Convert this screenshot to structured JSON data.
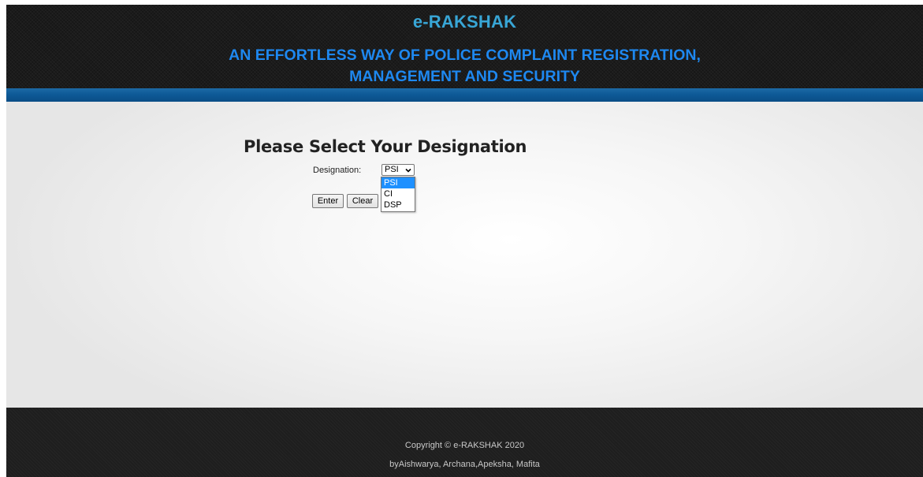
{
  "header": {
    "title": "e-RAKSHAK",
    "tagline_line1": "AN EFFORTLESS WAY OF POLICE COMPLAINT REGISTRATION,",
    "tagline_line2": "MANAGEMENT AND SECURITY"
  },
  "form": {
    "heading": "Please Select Your Designation",
    "designation_label": "Designation:",
    "designation_value": "PSI",
    "designation_options": [
      "PSI",
      "CI",
      "DSP"
    ],
    "enter_label": "Enter",
    "clear_label": "Clear"
  },
  "footer": {
    "copyright": "Copyright © e-RAKSHAK 2020",
    "credits": "byAishwarya, Archana,Apeksha, Mafita"
  },
  "colors": {
    "title": "#38a6d6",
    "tagline": "#1e88f0",
    "band": "#0e5a97",
    "selected_option": "#1e90ff"
  },
  "icons": {
    "select_arrow": "chevron-down-icon"
  }
}
